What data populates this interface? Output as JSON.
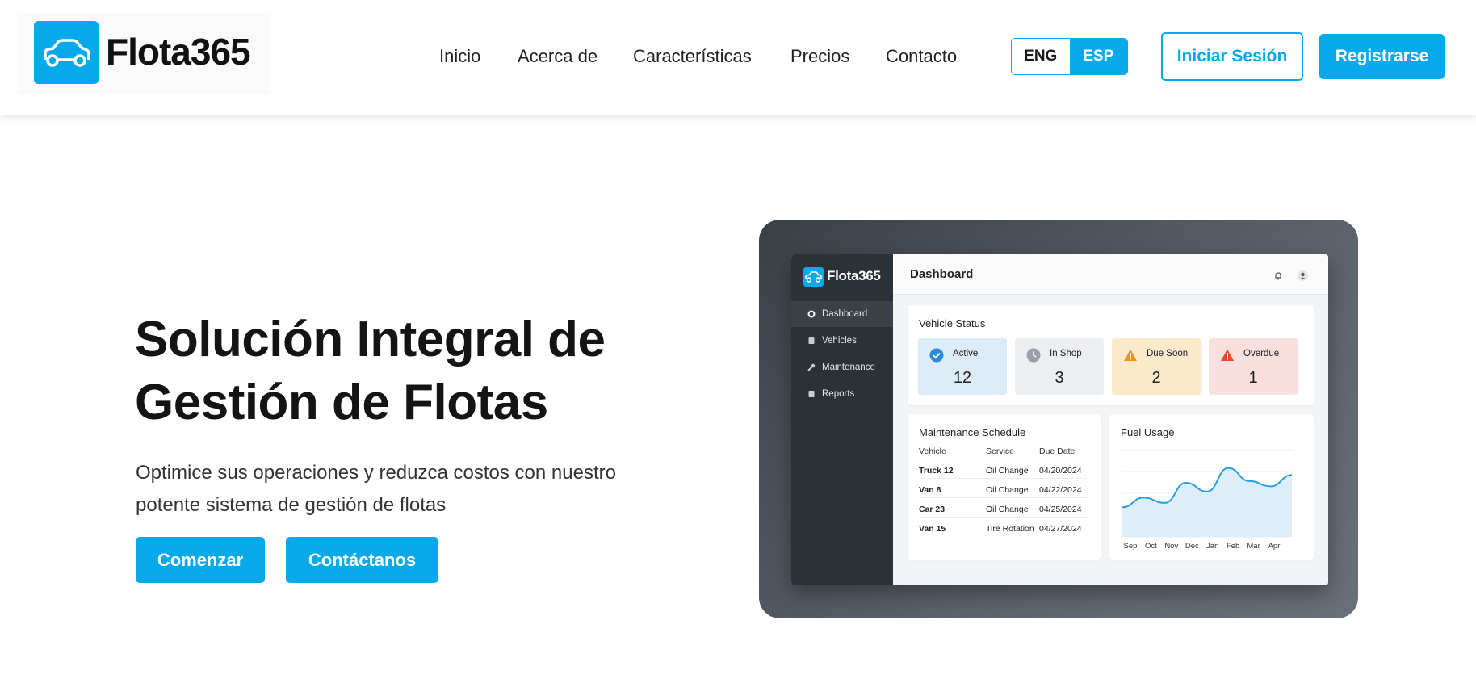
{
  "brand": {
    "name": "Flota365",
    "accent": "#06a9ea"
  },
  "nav": {
    "links": [
      "Inicio",
      "Acerca de",
      "Características",
      "Precios",
      "Contacto"
    ],
    "lang": {
      "eng": "ENG",
      "esp": "ESP",
      "selected": "ESP"
    },
    "login": "Iniciar Sesión",
    "register": "Registrarse"
  },
  "hero": {
    "title": "Solución Integral de Gestión de Flotas",
    "subtitle": "Optimice sus operaciones y reduzca costos con nuestro potente sistema de gestión de flotas",
    "primary_button": "Comenzar",
    "secondary_button": "Contáctanos"
  },
  "mockup": {
    "brand": "Flota365",
    "page_title": "Dashboard",
    "sidebar": [
      {
        "label": "Dashboard",
        "icon": "circle-icon",
        "active": true
      },
      {
        "label": "Vehicles",
        "icon": "document-icon",
        "active": false
      },
      {
        "label": "Maintenance",
        "icon": "wrench-icon",
        "active": false
      },
      {
        "label": "Reports",
        "icon": "document-icon",
        "active": false
      }
    ],
    "vehicle_status": {
      "title": "Vehicle Status",
      "items": [
        {
          "label": "Active",
          "value": "12",
          "bg": "#dcecf7",
          "icon_color": "#2c8ad8",
          "icon": "check-circle-icon"
        },
        {
          "label": "In Shop",
          "value": "3",
          "bg": "#eceef0",
          "icon_color": "#9aa0a6",
          "icon": "clock-icon"
        },
        {
          "label": "Due Soon",
          "value": "2",
          "bg": "#fbe9cc",
          "icon_color": "#f0921e",
          "icon": "warning-icon"
        },
        {
          "label": "Overdue",
          "value": "1",
          "bg": "#f9e0de",
          "icon_color": "#e04a2f",
          "icon": "warning-icon"
        }
      ]
    },
    "maintenance": {
      "title": "Maintenance Schedule",
      "columns": [
        "Vehicle",
        "Service",
        "Due Date"
      ],
      "rows": [
        [
          "Truck 12",
          "Oil Change",
          "04/20/2024"
        ],
        [
          "Van 8",
          "Oil Change",
          "04/22/2024"
        ],
        [
          "Car 23",
          "Oil Change",
          "04/25/2024"
        ],
        [
          "Van 15",
          "Tire Rotation",
          "04/27/2024"
        ]
      ]
    },
    "fuel": {
      "title": "Fuel Usage"
    }
  },
  "chart_data": {
    "type": "area",
    "title": "Fuel Usage",
    "categories": [
      "Sep",
      "Oct",
      "Nov",
      "Dec",
      "Jan",
      "Feb",
      "Mar",
      "Apr"
    ],
    "x": [
      0,
      1,
      2,
      3,
      4,
      5,
      6,
      7,
      8
    ],
    "values": [
      34,
      45,
      39,
      62,
      52,
      79,
      64,
      58,
      71
    ],
    "xlabel": "",
    "ylabel": "",
    "ylim": [
      0,
      100
    ],
    "grid": true,
    "color": "#2c9ee0"
  }
}
